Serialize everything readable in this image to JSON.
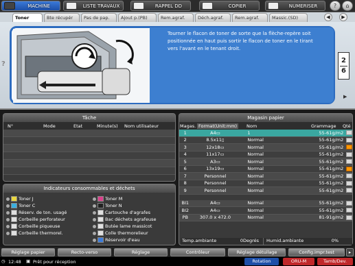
{
  "topbar": {
    "machine": "MACHINE",
    "job_list": "LISTE TRAVAUX",
    "recall": "RAPPEL DD",
    "copy": "COPIER",
    "scan": "NUMERISER",
    "help": "?"
  },
  "tabs": [
    "Toner",
    "Bte récupér",
    "Pas de pap.",
    "Ajout p.(PB)",
    "Rem.agraf.",
    "Déch.agraf.",
    "Rem.agraf.",
    "Massic.(SD)"
  ],
  "guide": {
    "instruction": "Tourner le flacon de toner de sorte que la flèche-repère soit positionnée en haut puis sortir le flacon de toner en le tirant vers l'avant en le tenant droit.",
    "page_current": "2",
    "page_total": "6",
    "question": "?"
  },
  "job_panel": {
    "title": "Tâche",
    "columns": [
      "N°",
      "Mode",
      "Etat",
      "Minute(s)",
      "Nom utilisateur"
    ]
  },
  "consumables": {
    "title": "Indicateurs consommables et déchets",
    "left": [
      "Toner J",
      "Toner C",
      "Réserv. de ton. usagé",
      "Corbeille perforateur",
      "Corbeille piqueuse",
      "Corbeille thermorel."
    ],
    "right": [
      "Toner M",
      "Toner N",
      "Cartouche d'agrafes",
      "Bac déchets agrafeuse",
      "Butée lame massicot",
      "Colle thermorelieur",
      "Réservoir d'eau"
    ]
  },
  "magasin": {
    "title": "Magasin papier",
    "columns": [
      "Magas.",
      "Format(Unit:mm)",
      "Nom",
      "Grammage",
      "Qté"
    ],
    "rows": [
      {
        "id": "1",
        "format": "A4▭",
        "name": "1",
        "grammage": "55-61g/m2",
        "level": "normal"
      },
      {
        "id": "2",
        "format": "8.5x11▯",
        "name": "Normal",
        "grammage": "55-61g/m2",
        "level": "normal"
      },
      {
        "id": "3",
        "format": "12x18▭",
        "name": "Normal",
        "grammage": "55-61g/m2",
        "level": "warn"
      },
      {
        "id": "4",
        "format": "11x17▭",
        "name": "Normal",
        "grammage": "55-61g/m2",
        "level": "normal"
      },
      {
        "id": "5",
        "format": "A3▭",
        "name": "Normal",
        "grammage": "55-61g/m2",
        "level": "normal"
      },
      {
        "id": "6",
        "format": "13x19▭",
        "name": "Normal",
        "grammage": "55-61g/m2",
        "level": "warn"
      },
      {
        "id": "7",
        "format": "Personnel",
        "name": "Normal",
        "grammage": "55-61g/m2",
        "level": "normal"
      },
      {
        "id": "8",
        "format": "Personnel",
        "name": "Normal",
        "grammage": "55-61g/m2",
        "level": "normal"
      },
      {
        "id": "9",
        "format": "Personnel",
        "name": "Normal",
        "grammage": "55-61g/m2",
        "level": "normal"
      }
    ],
    "bypass": [
      {
        "id": "BI1",
        "format": "A4▭",
        "name": "Normal",
        "grammage": "55-61g/m2"
      },
      {
        "id": "BI2",
        "format": "A4▭",
        "name": "Normal",
        "grammage": "55-61g/m2"
      },
      {
        "id": "PB",
        "format": "307.0 x 472.0",
        "name": "Normal",
        "grammage": "81-91g/m2"
      }
    ],
    "temp_label": "Temp.ambiante",
    "temp_value": "0Degrés",
    "humid_label": "Humid.ambiante",
    "humid_value": "0%"
  },
  "bottom_buttons": [
    "Réglage papier",
    "Recto-verso",
    "Réglage",
    "Contrôleur",
    "Réglage détuilage",
    "Config.impr.test"
  ],
  "status": {
    "time": "12:48",
    "message": "Prêt pour réception",
    "rotation": "Rotation",
    "oru": "ORU-M",
    "tamb": "Tamb/Dev."
  }
}
